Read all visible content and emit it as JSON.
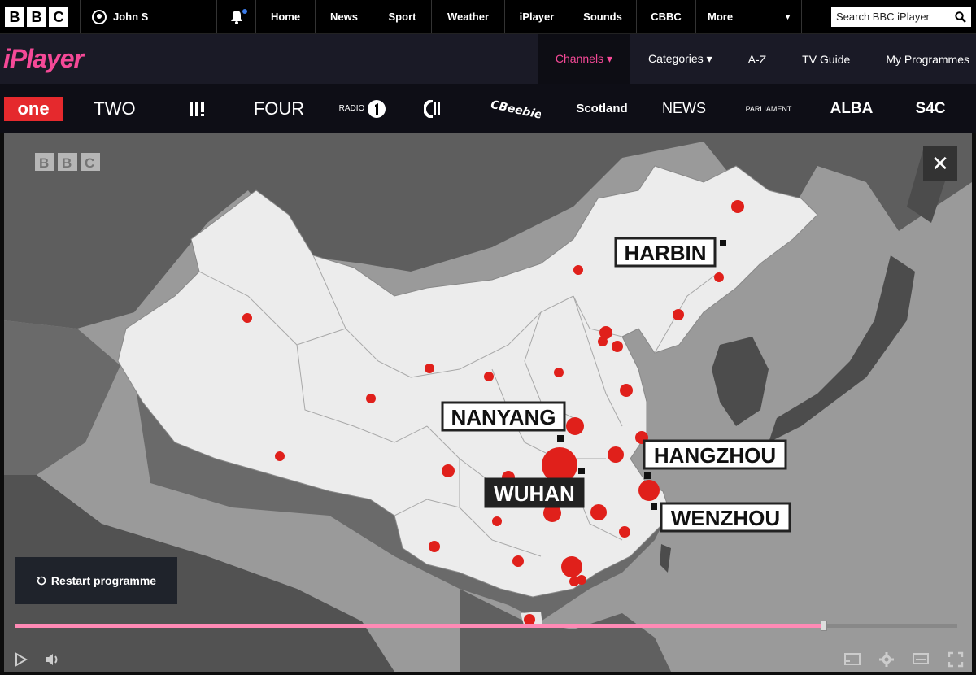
{
  "topbar": {
    "logo_letters": [
      "B",
      "B",
      "C"
    ],
    "account_name": "John S",
    "nav": [
      "Home",
      "News",
      "Sport",
      "Weather",
      "iPlayer",
      "Sounds",
      "CBBC"
    ],
    "more_label": "More",
    "search_placeholder": "Search BBC iPlayer"
  },
  "iplayer": {
    "logo": "iPlayer",
    "nav": [
      {
        "label": "Channels ▾",
        "active": true
      },
      {
        "label": "Categories ▾",
        "active": false
      },
      {
        "label": "A-Z",
        "active": false
      },
      {
        "label": "TV Guide",
        "active": false
      },
      {
        "label": "My Programmes",
        "active": false
      }
    ]
  },
  "channels": [
    {
      "name": "one",
      "type": "badge"
    },
    {
      "name": "TWO",
      "type": "text"
    },
    {
      "name": "III",
      "type": "three"
    },
    {
      "name": "FOUR",
      "type": "text"
    },
    {
      "name": "RADIO",
      "type": "radio1"
    },
    {
      "name": "CBBC",
      "type": "cbbc"
    },
    {
      "name": "CBeebies",
      "type": "cbeebies"
    },
    {
      "name": "Scotland",
      "type": "text"
    },
    {
      "name": "NEWS",
      "type": "text"
    },
    {
      "name": "PARLIAMENT",
      "type": "small"
    },
    {
      "name": "ALBA",
      "type": "text"
    },
    {
      "name": "S4C",
      "type": "text"
    }
  ],
  "player": {
    "watermark": "BBC",
    "close": "✕",
    "restart_label": "Restart programme",
    "progress": 0.858,
    "cities": [
      "HARBIN",
      "NANYANG",
      "HANGZHOU",
      "WUHAN",
      "WENZHOU"
    ]
  }
}
